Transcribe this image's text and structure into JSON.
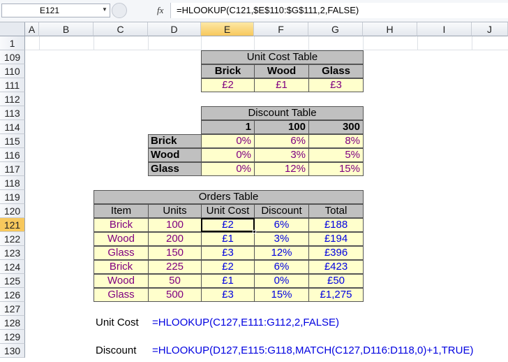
{
  "formula_bar": {
    "name_box": "E121",
    "fx_label": "fx",
    "formula": "=HLOOKUP(C121,$E$110:$G$111,2,FALSE)"
  },
  "columns": [
    "A",
    "B",
    "C",
    "D",
    "E",
    "F",
    "G",
    "H",
    "I",
    "J"
  ],
  "rows": [
    "1",
    "109",
    "110",
    "111",
    "112",
    "113",
    "114",
    "115",
    "116",
    "117",
    "118",
    "119",
    "120",
    "121",
    "122",
    "123",
    "124",
    "125",
    "126",
    "127",
    "128",
    "129",
    "130"
  ],
  "unit_cost_table": {
    "title": "Unit Cost Table",
    "headers": [
      "Brick",
      "Wood",
      "Glass"
    ],
    "values": [
      "£2",
      "£1",
      "£3"
    ]
  },
  "discount_table": {
    "title": "Discount Table",
    "qty_headers": [
      "1",
      "100",
      "300"
    ],
    "rows": [
      {
        "label": "Brick",
        "values": [
          "0%",
          "6%",
          "8%"
        ]
      },
      {
        "label": "Wood",
        "values": [
          "0%",
          "3%",
          "5%"
        ]
      },
      {
        "label": "Glass",
        "values": [
          "0%",
          "12%",
          "15%"
        ]
      }
    ]
  },
  "orders_table": {
    "title": "Orders Table",
    "headers": [
      "Item",
      "Units",
      "Unit Cost",
      "Discount",
      "Total"
    ],
    "rows": [
      [
        "Brick",
        "100",
        "£2",
        "6%",
        "£188"
      ],
      [
        "Wood",
        "200",
        "£1",
        "3%",
        "£194"
      ],
      [
        "Glass",
        "150",
        "£3",
        "12%",
        "£396"
      ],
      [
        "Brick",
        "225",
        "£2",
        "6%",
        "£423"
      ],
      [
        "Wood",
        "50",
        "£1",
        "0%",
        "£50"
      ],
      [
        "Glass",
        "500",
        "£3",
        "15%",
        "£1,275"
      ]
    ]
  },
  "notes": {
    "unit_cost_label": "Unit Cost",
    "unit_cost_formula": "=HLOOKUP(C127,E111:G112,2,FALSE)",
    "discount_label": "Discount",
    "discount_formula": "=HLOOKUP(D127,E115:G118,MATCH(C127,D116:D118,0)+1,TRUE)"
  },
  "selected": {
    "column": "E",
    "row": "121"
  }
}
